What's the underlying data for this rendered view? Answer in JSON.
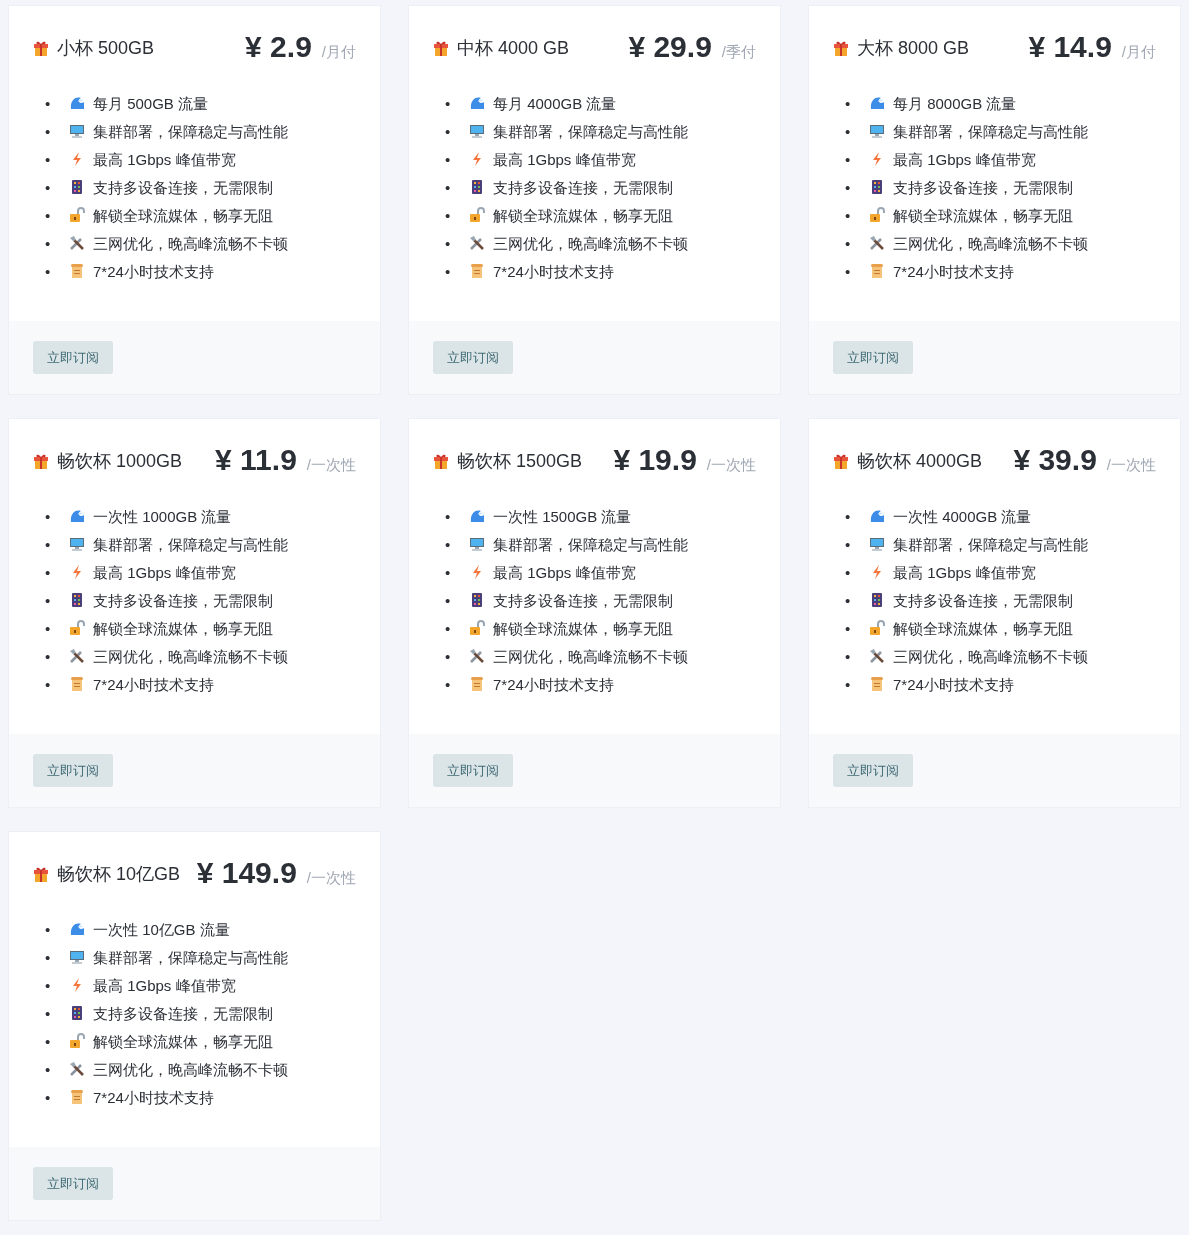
{
  "plans": [
    {
      "name": "小杯 500GB",
      "price": "¥ 2.9",
      "period": "/月付",
      "button": "立即订阅",
      "features": [
        {
          "marker": "•",
          "kind": "wave",
          "text": "每月 500GB 流量"
        },
        {
          "marker": "•",
          "kind": "monitor",
          "text": "集群部署，保障稳定与高性能"
        },
        {
          "marker": "•",
          "kind": "bolt",
          "text": "最高 1Gbps 峰值带宽"
        },
        {
          "marker": "•",
          "kind": "grid",
          "text": "支持多设备连接，无需限制"
        },
        {
          "marker": "•",
          "kind": "lock",
          "text": "解锁全球流媒体，畅享无阻"
        },
        {
          "marker": "•",
          "kind": "tools",
          "text": "三网优化，晚高峰流畅不卡顿"
        },
        {
          "marker": "•",
          "kind": "scroll",
          "text": "7*24小时技术支持"
        }
      ]
    },
    {
      "name": "中杯 4000 GB",
      "price": "¥ 29.9",
      "period": "/季付",
      "button": "立即订阅",
      "features": [
        {
          "marker": "•",
          "kind": "wave",
          "text": "每月 4000GB 流量"
        },
        {
          "marker": "•",
          "kind": "monitor",
          "text": "集群部署，保障稳定与高性能"
        },
        {
          "marker": "•",
          "kind": "bolt",
          "text": "最高 1Gbps 峰值带宽"
        },
        {
          "marker": "•",
          "kind": "grid",
          "text": "支持多设备连接，无需限制"
        },
        {
          "marker": "•",
          "kind": "lock",
          "text": "解锁全球流媒体，畅享无阻"
        },
        {
          "marker": "•",
          "kind": "tools",
          "text": "三网优化，晚高峰流畅不卡顿"
        },
        {
          "marker": "•",
          "kind": "scroll",
          "text": "7*24小时技术支持"
        }
      ]
    },
    {
      "name": "大杯 8000 GB",
      "price": "¥ 14.9",
      "period": "/月付",
      "button": "立即订阅",
      "features": [
        {
          "marker": "•",
          "kind": "wave",
          "text": "每月 8000GB 流量"
        },
        {
          "marker": "•",
          "kind": "monitor",
          "text": "集群部署，保障稳定与高性能"
        },
        {
          "marker": "•",
          "kind": "bolt",
          "text": "最高 1Gbps 峰值带宽"
        },
        {
          "marker": "•",
          "kind": "grid",
          "text": "支持多设备连接，无需限制"
        },
        {
          "marker": "•",
          "kind": "lock",
          "text": "解锁全球流媒体，畅享无阻"
        },
        {
          "marker": "•",
          "kind": "tools",
          "text": "三网优化，晚高峰流畅不卡顿"
        },
        {
          "marker": "•",
          "kind": "scroll",
          "text": "7*24小时技术支持"
        }
      ]
    },
    {
      "name": "畅饮杯 1000GB",
      "price": "¥ 11.9",
      "period": "/一次性",
      "button": "立即订阅",
      "features": [
        {
          "marker": "•",
          "kind": "wave",
          "text": "一次性 1000GB 流量"
        },
        {
          "marker": "•",
          "kind": "monitor",
          "text": "集群部署，保障稳定与高性能"
        },
        {
          "marker": "•",
          "kind": "bolt",
          "text": "最高 1Gbps 峰值带宽"
        },
        {
          "marker": "•",
          "kind": "grid",
          "text": "支持多设备连接，无需限制"
        },
        {
          "marker": "•",
          "kind": "lock",
          "text": "解锁全球流媒体，畅享无阻"
        },
        {
          "marker": "•",
          "kind": "tools",
          "text": "三网优化，晚高峰流畅不卡顿"
        },
        {
          "marker": "•",
          "kind": "scroll",
          "text": "7*24小时技术支持"
        }
      ]
    },
    {
      "name": "畅饮杯 1500GB",
      "price": "¥ 19.9",
      "period": "/一次性",
      "button": "立即订阅",
      "features": [
        {
          "marker": "•",
          "kind": "wave",
          "text": "一次性 1500GB 流量"
        },
        {
          "marker": "•",
          "kind": "monitor",
          "text": "集群部署，保障稳定与高性能"
        },
        {
          "marker": "•",
          "kind": "bolt",
          "text": "最高 1Gbps 峰值带宽"
        },
        {
          "marker": "•",
          "kind": "grid",
          "text": "支持多设备连接，无需限制"
        },
        {
          "marker": "•",
          "kind": "lock",
          "text": "解锁全球流媒体，畅享无阻"
        },
        {
          "marker": "•",
          "kind": "tools",
          "text": "三网优化，晚高峰流畅不卡顿"
        },
        {
          "marker": "•",
          "kind": "scroll",
          "text": "7*24小时技术支持"
        }
      ]
    },
    {
      "name": "畅饮杯 4000GB",
      "price": "¥ 39.9",
      "period": "/一次性",
      "button": "立即订阅",
      "features": [
        {
          "marker": "•",
          "kind": "wave",
          "text": "一次性 4000GB 流量"
        },
        {
          "marker": "•",
          "kind": "monitor",
          "text": "集群部署，保障稳定与高性能"
        },
        {
          "marker": "•",
          "kind": "bolt",
          "text": "最高 1Gbps 峰值带宽"
        },
        {
          "marker": "•",
          "kind": "grid",
          "text": "支持多设备连接，无需限制"
        },
        {
          "marker": "•",
          "kind": "lock",
          "text": "解锁全球流媒体，畅享无阻"
        },
        {
          "marker": "•",
          "kind": "tools",
          "text": "三网优化，晚高峰流畅不卡顿"
        },
        {
          "marker": "•",
          "kind": "scroll",
          "text": "7*24小时技术支持"
        }
      ]
    },
    {
      "name": "畅饮杯 10亿GB",
      "price": "¥ 149.9",
      "period": "/一次性",
      "button": "立即订阅",
      "features": [
        {
          "marker": "•",
          "kind": "wave",
          "text": "一次性 10亿GB 流量"
        },
        {
          "marker": "•",
          "kind": "monitor",
          "text": "集群部署，保障稳定与高性能"
        },
        {
          "marker": "•",
          "kind": "bolt",
          "text": "最高 1Gbps 峰值带宽"
        },
        {
          "marker": "•",
          "kind": "grid",
          "text": "支持多设备连接，无需限制"
        },
        {
          "marker": "•",
          "kind": "lock",
          "text": "解锁全球流媒体，畅享无阻"
        },
        {
          "marker": "•",
          "kind": "tools",
          "text": "三网优化，晚高峰流畅不卡顿"
        },
        {
          "marker": "•",
          "kind": "scroll",
          "text": "7*24小时技术支持"
        }
      ]
    }
  ]
}
